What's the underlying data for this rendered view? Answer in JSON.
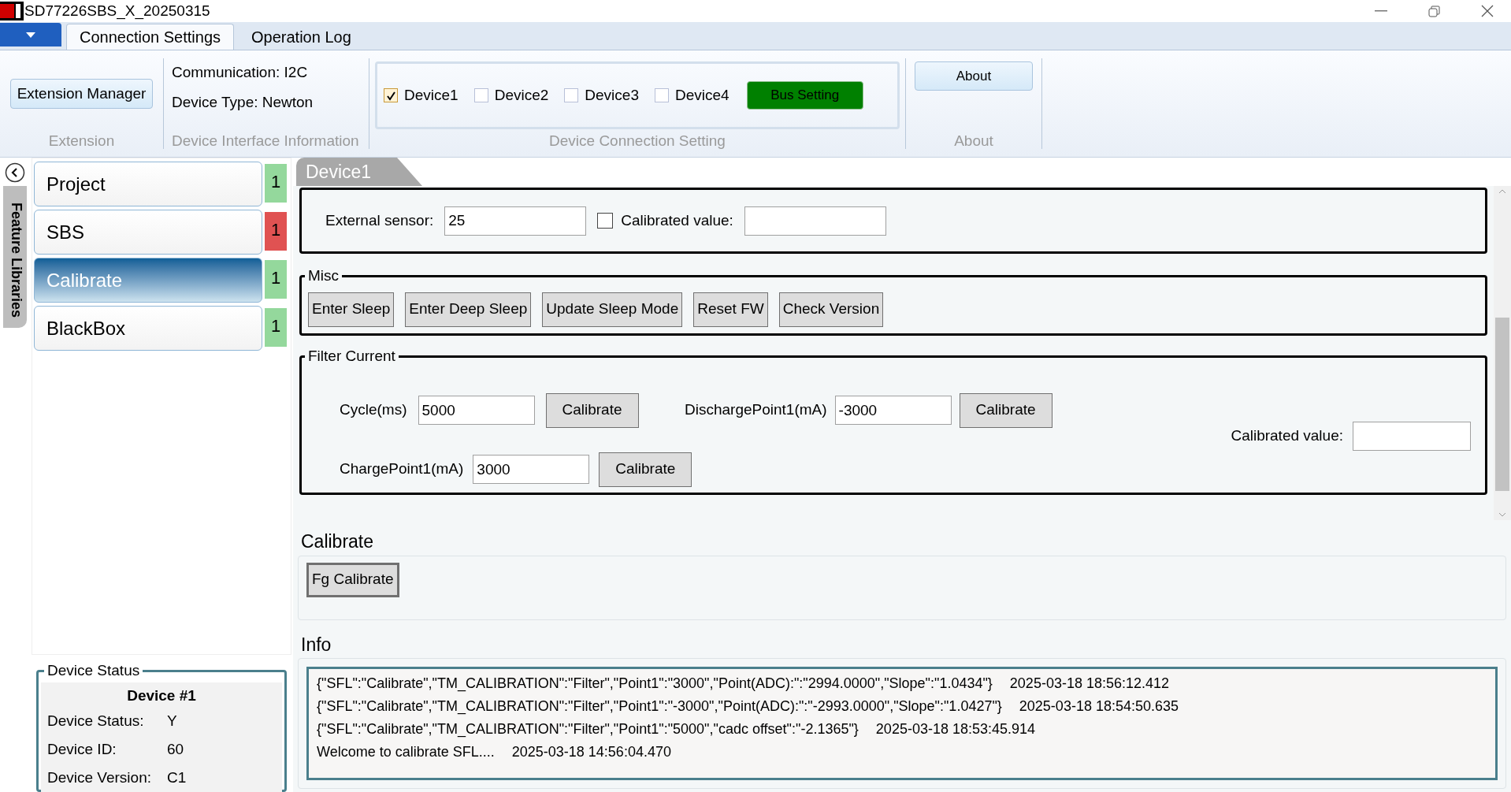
{
  "window": {
    "title": "SD77226SBS_X_20250315"
  },
  "menu_tabs": [
    {
      "label": "Connection Settings",
      "selected": true
    },
    {
      "label": "Operation Log",
      "selected": false
    }
  ],
  "extension": {
    "button": "Extension Manager",
    "caption": "Extension"
  },
  "interface_info": {
    "lines": [
      "Communication: I2C",
      "Device Type: Newton"
    ],
    "caption": "Device Interface Information"
  },
  "connection": {
    "devices": [
      {
        "label": "Device1",
        "checked": true
      },
      {
        "label": "Device2",
        "checked": false
      },
      {
        "label": "Device3",
        "checked": false
      },
      {
        "label": "Device4",
        "checked": false
      }
    ],
    "bus_button": "Bus Setting",
    "caption": "Device Connection Setting"
  },
  "about": {
    "button": "About",
    "caption": "About"
  },
  "sidebar": {
    "tab_label": "Feature Libraries",
    "items": [
      {
        "label": "Project",
        "selected": false,
        "count": "1",
        "color": "#94d89c"
      },
      {
        "label": "SBS",
        "selected": false,
        "count": "1",
        "color": "#e05252"
      },
      {
        "label": "Calibrate",
        "selected": true,
        "count": "1",
        "color": "#94d89c"
      },
      {
        "label": "BlackBox",
        "selected": false,
        "count": "1",
        "color": "#94d89c"
      }
    ]
  },
  "device_status": {
    "title": "Device Status",
    "device": "Device #1",
    "fields": [
      {
        "label": "Device Status:",
        "value": "Y"
      },
      {
        "label": "Device ID:",
        "value": "60"
      },
      {
        "label": "Device Version:",
        "value": "C1"
      }
    ]
  },
  "device_tab": "Device1",
  "external": {
    "sensor_label": "External sensor:",
    "sensor_value": "25",
    "calibrated_checked": false,
    "calibrated_label": "Calibrated value:"
  },
  "misc": {
    "title": "Misc",
    "buttons": [
      "Enter Sleep",
      "Enter Deep Sleep",
      "Update Sleep Mode",
      "Reset FW",
      "Check Version"
    ]
  },
  "filter": {
    "title": "Filter Current",
    "cycle": {
      "label": "Cycle(ms)",
      "value": "5000",
      "button": "Calibrate"
    },
    "discharge": {
      "label": "DischargePoint1(mA)",
      "value": "-3000",
      "button": "Calibrate"
    },
    "charge": {
      "label": "ChargePoint1(mA)",
      "value": "3000",
      "button": "Calibrate"
    },
    "calibrated_label": "Calibrated value:"
  },
  "calibrate": {
    "title": "Calibrate",
    "button": "Fg Calibrate"
  },
  "info": {
    "title": "Info",
    "lines": [
      {
        "text": "{\"SFL\":\"Calibrate\",\"TM_CALIBRATION\":\"Filter\",\"Point1\":\"3000\",\"Point(ADC):\":\"2994.0000\",\"Slope\":\"1.0434\"}",
        "time": "2025-03-18 18:56:12.412"
      },
      {
        "text": "{\"SFL\":\"Calibrate\",\"TM_CALIBRATION\":\"Filter\",\"Point1\":\"-3000\",\"Point(ADC):\":\"-2993.0000\",\"Slope\":\"1.0427\"}",
        "time": "2025-03-18 18:54:50.635"
      },
      {
        "text": "{\"SFL\":\"Calibrate\",\"TM_CALIBRATION\":\"Filter\",\"Point1\":\"5000\",\"cadc offset\":\"-2.1365\"}",
        "time": "2025-03-18 18:53:45.914"
      },
      {
        "text": "Welcome to calibrate SFL....",
        "time": "2025-03-18 14:56:04.470"
      }
    ]
  }
}
